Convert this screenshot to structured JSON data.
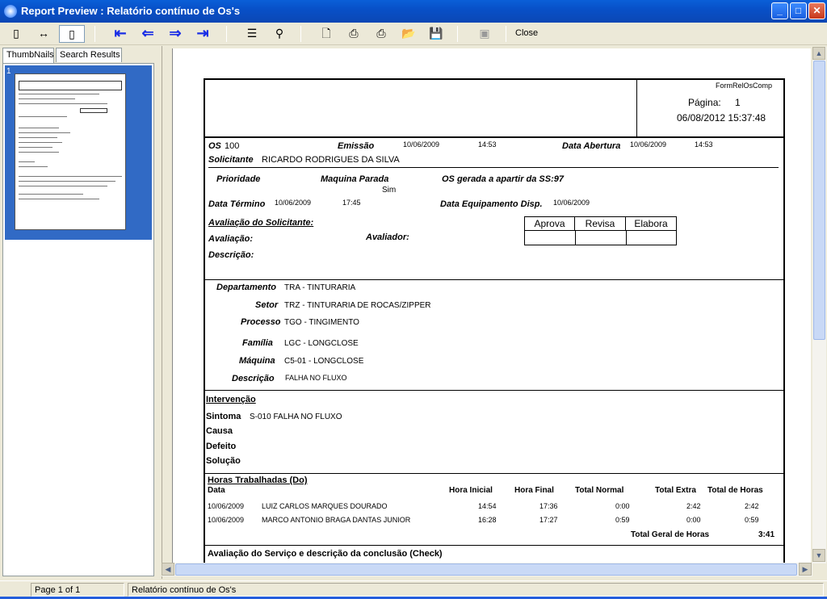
{
  "window": {
    "title": "Report Preview : Relatório contínuo de Os's",
    "min": "_",
    "max": "□",
    "close": "✕"
  },
  "toolbar": {
    "close_label": "Close"
  },
  "tabs": [
    "ThumbNails",
    "Search Results"
  ],
  "thumbnails": {
    "page_number": "1"
  },
  "report": {
    "form_name": "FormRelOsComp",
    "page_label": "Página:",
    "page_value": "1",
    "printed_at": "06/08/2012 15:37:48",
    "os_label": "OS",
    "os_value": "100",
    "emissao_label": "Emissão",
    "emissao_date": "10/06/2009",
    "emissao_time": "14:53",
    "abertura_label": "Data Abertura",
    "abertura_date": "10/06/2009",
    "abertura_time": "14:53",
    "solicitante_label": "Solicitante",
    "solicitante_value": "RICARDO RODRIGUES DA SILVA",
    "prioridade_label": "Prioridade",
    "maquina_parada_label": "Maquina Parada",
    "maquina_parada_value": "Sim",
    "os_gerada_label": "OS gerada a apartir da SS:97",
    "termino_label": "Data Término",
    "termino_date": "10/06/2009",
    "termino_time": "17:45",
    "equip_disp_label": "Data Equipamento Disp.",
    "equip_disp_value": "10/06/2009",
    "avaliacao_solicitante_label": "Avaliação do Solicitante:",
    "avaliacao_label": "Avaliação:",
    "avaliador_label": "Avaliador:",
    "descricao1_label": "Descrição:",
    "approval": [
      "Aprova",
      "Revisa",
      "Elabora"
    ],
    "departamento_label": "Departamento",
    "departamento_value": "TRA - TINTURARIA",
    "setor_label": "Setor",
    "setor_value": "TRZ - TINTURARIA DE ROCAS/ZIPPER",
    "processo_label": "Processo",
    "processo_value": "TGO - TINGIMENTO",
    "familia_label": "Família",
    "familia_value": "LGC - LONGCLOSE",
    "maquina_label": "Máquina",
    "maquina_value": "C5-01 - LONGCLOSE",
    "descricao2_label": "Descrição",
    "descricao2_value": "FALHA NO FLUXO",
    "intervencao_label": "Intervenção",
    "sintoma_label": "Sintoma",
    "sintoma_value": "S-010 FALHA NO FLUXO",
    "causa_label": "Causa",
    "defeito_label": "Defeito",
    "solucao_label": "Solução",
    "horas_label": "Horas Trabalhadas (Do)",
    "hours_headers": [
      "Data",
      "Hora Inicial",
      "Hora Final",
      "Total Normal",
      "Total Extra",
      "Total de Horas"
    ],
    "hours_rows": [
      [
        "10/06/2009",
        "LUIZ CARLOS MARQUES DOURADO",
        "14:54",
        "17:36",
        "0:00",
        "2:42",
        "2:42"
      ],
      [
        "10/06/2009",
        "MARCO ANTONIO BRAGA DANTAS JUNIOR",
        "16:28",
        "17:27",
        "0:59",
        "0:00",
        "0:59"
      ]
    ],
    "total_geral_label": "Total Geral de Horas",
    "total_geral_value": "3:41",
    "avaliacao_servico_label": "Avaliação do Serviço e descrição da conclusão (Check)"
  },
  "status": {
    "page": "Page 1 of 1",
    "report_name": "Relatório contínuo de Os's"
  }
}
